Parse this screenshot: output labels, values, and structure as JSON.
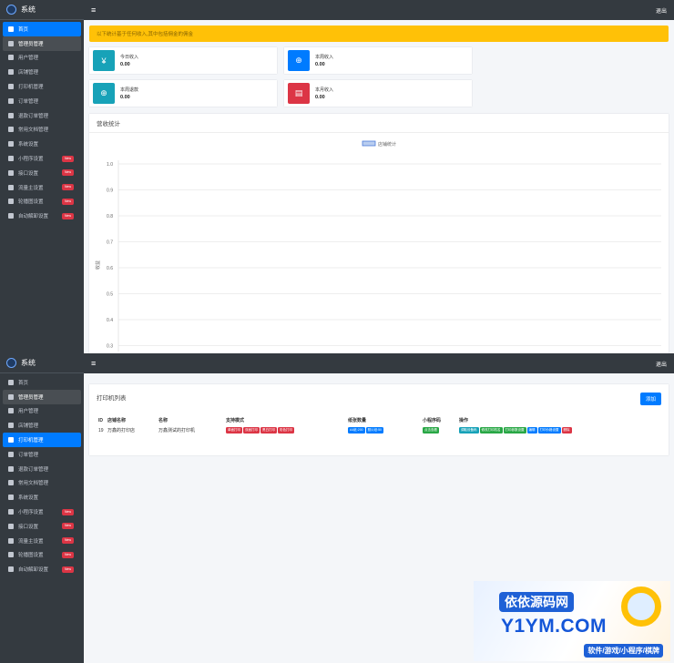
{
  "brand": {
    "title": "系统"
  },
  "navbar": {
    "logout": "退出"
  },
  "menu_top": [
    {
      "label": "首页",
      "state": "active",
      "icon": "home-icon"
    },
    {
      "label": "管理员管理",
      "state": "selected",
      "icon": "user-tie-icon"
    },
    {
      "label": "用户管理",
      "state": "",
      "icon": "user-icon"
    },
    {
      "label": "店铺管理",
      "state": "",
      "icon": "store-icon"
    },
    {
      "label": "打印机管理",
      "state": "",
      "icon": "printer-icon"
    },
    {
      "label": "订单管理",
      "state": "",
      "icon": "order-icon"
    },
    {
      "label": "退款订单管理",
      "state": "",
      "icon": "refund-icon"
    },
    {
      "label": "常用文档管理",
      "state": "",
      "icon": "document-icon"
    },
    {
      "label": "系统设置",
      "state": "",
      "icon": "cogs-icon"
    },
    {
      "label": "小程序设置",
      "state": "",
      "badge": "New",
      "icon": "heart-icon"
    },
    {
      "label": "接口设置",
      "state": "",
      "badge": "New",
      "icon": "heart-icon"
    },
    {
      "label": "流量主设置",
      "state": "",
      "badge": "New",
      "icon": "id-card-icon"
    },
    {
      "label": "轮播图设置",
      "state": "",
      "badge": "New",
      "icon": "image-icon"
    },
    {
      "label": "自动解卸设置",
      "state": "",
      "badge": "New",
      "icon": "clipboard-icon"
    }
  ],
  "menu_bottom": [
    {
      "label": "首页",
      "state": "",
      "icon": "home-icon"
    },
    {
      "label": "管理员管理",
      "state": "selected",
      "icon": "user-tie-icon"
    },
    {
      "label": "用户管理",
      "state": "",
      "icon": "user-icon"
    },
    {
      "label": "店铺管理",
      "state": "",
      "icon": "store-icon"
    },
    {
      "label": "打印机管理",
      "state": "active",
      "icon": "printer-icon"
    },
    {
      "label": "订单管理",
      "state": "",
      "icon": "order-icon"
    },
    {
      "label": "退款订单管理",
      "state": "",
      "icon": "refund-icon"
    },
    {
      "label": "常用文档管理",
      "state": "",
      "icon": "document-icon"
    },
    {
      "label": "系统设置",
      "state": "",
      "icon": "cogs-icon"
    },
    {
      "label": "小程序设置",
      "state": "",
      "badge": "New",
      "icon": "heart-icon"
    },
    {
      "label": "接口设置",
      "state": "",
      "badge": "New",
      "icon": "heart-icon"
    },
    {
      "label": "流量主设置",
      "state": "",
      "badge": "New",
      "icon": "id-card-icon"
    },
    {
      "label": "轮播图设置",
      "state": "",
      "badge": "New",
      "icon": "image-icon"
    },
    {
      "label": "自动解卸设置",
      "state": "",
      "badge": "New",
      "icon": "clipboard-icon"
    }
  ],
  "alert": {
    "text": "以下统计基于任何收入,其中包括佣金的佣金"
  },
  "stats": [
    {
      "label": "今日收入",
      "value": "0.00",
      "color": "#17a2b8",
      "glyph": "¥",
      "icon": "yen-icon"
    },
    {
      "label": "本周收入",
      "value": "0.00",
      "color": "#007bff",
      "glyph": "⊕",
      "icon": "search-dollar-icon"
    },
    {
      "label": "本周退款",
      "value": "0.00",
      "color": "#17a2b8",
      "glyph": "⊕",
      "icon": "search-dollar-icon"
    },
    {
      "label": "本月收入",
      "value": "0.00",
      "color": "#dc3545",
      "glyph": "▤",
      "icon": "wallet-icon"
    }
  ],
  "chart_card": {
    "title": "营收统计"
  },
  "chart_data": {
    "type": "line",
    "title": "",
    "legend": "店铺统计",
    "legend_position": "top-center",
    "ylabel": "收益",
    "xlabel": "",
    "ylim": [
      0.2,
      1.0
    ],
    "yticks": [
      "1.0",
      "0.9",
      "0.8",
      "0.7",
      "0.6",
      "0.5",
      "0.4",
      "0.3",
      "0.2"
    ],
    "grid": true,
    "series": [
      {
        "name": "店铺统计",
        "values": []
      }
    ]
  },
  "printer_list": {
    "title": "打印机列表",
    "add_button": "添加",
    "columns": [
      "ID",
      "店铺名称",
      "名称",
      "支持模式",
      "纸张数量",
      "小程序码",
      "操作"
    ],
    "rows": [
      {
        "id": "19",
        "shop": "万鑫的打印店",
        "name": "万鑫测试的打印机",
        "modes": [
          "单面打印",
          "双面打印",
          "黑白打印",
          "彩色打印"
        ],
        "paper": [
          "A4纸:200",
          "照片纸:50"
        ],
        "qrcode": "点击查看",
        "actions": [
          "调取设备码",
          "修改打印机名",
          "打印参数设置",
          "编辑",
          "打印价格设置",
          "删除"
        ]
      }
    ]
  },
  "watermark": {
    "line1": "依依源码网",
    "line2": "Y1YM.COM",
    "line3": "软件/游戏/小程序/棋牌"
  }
}
